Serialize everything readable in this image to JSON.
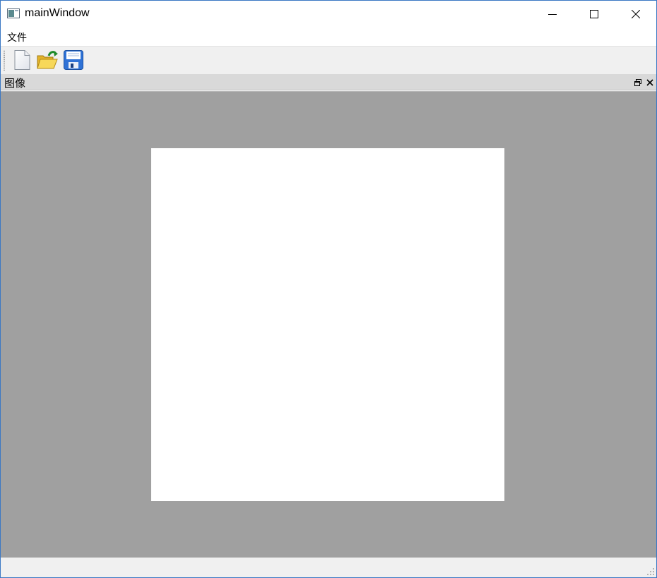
{
  "window": {
    "title": "mainWindow"
  },
  "menu": {
    "items": [
      {
        "label": "文件"
      }
    ]
  },
  "toolbar": {
    "buttons": [
      {
        "icon": "new-file-icon"
      },
      {
        "icon": "open-folder-icon"
      },
      {
        "icon": "save-icon"
      }
    ]
  },
  "dock": {
    "title": "图像",
    "float_icon": "float-icon",
    "close_icon": "close-icon"
  },
  "colors": {
    "dock_background": "#a0a0a0",
    "canvas": "#ffffff",
    "window_border": "#3a78c4"
  }
}
